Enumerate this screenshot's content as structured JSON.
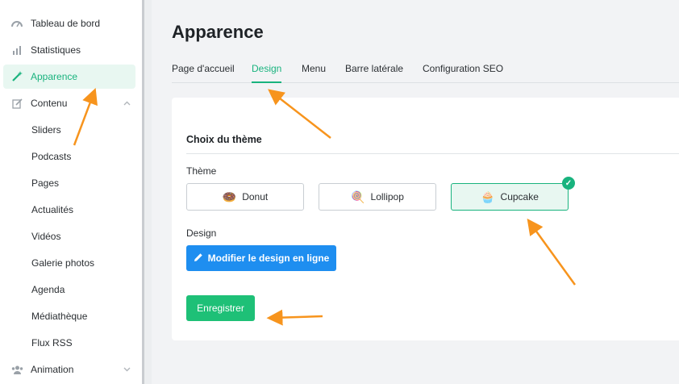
{
  "sidebar": {
    "items": [
      {
        "label": "Tableau de bord",
        "icon": "dashboard-icon"
      },
      {
        "label": "Statistiques",
        "icon": "stats-icon"
      },
      {
        "label": "Apparence",
        "icon": "magic-wand-icon",
        "active": true
      },
      {
        "label": "Contenu",
        "icon": "edit-icon",
        "expanded": true
      },
      {
        "label": "Animation",
        "icon": "users-icon",
        "expanded": false
      }
    ],
    "sub_items": [
      "Sliders",
      "Podcasts",
      "Pages",
      "Actualités",
      "Vidéos",
      "Galerie photos",
      "Agenda",
      "Médiathèque",
      "Flux RSS"
    ]
  },
  "main": {
    "title": "Apparence",
    "tabs": [
      {
        "label": "Page d'accueil"
      },
      {
        "label": "Design",
        "active": true
      },
      {
        "label": "Menu"
      },
      {
        "label": "Barre latérale"
      },
      {
        "label": "Configuration SEO"
      }
    ],
    "section_title": "Choix du thème",
    "theme_label": "Thème",
    "themes": [
      {
        "label": "Donut",
        "emoji": "🍩"
      },
      {
        "label": "Lollipop",
        "emoji": "🍭"
      },
      {
        "label": "Cupcake",
        "emoji": "🧁",
        "selected": true
      }
    ],
    "design_label": "Design",
    "design_button": "Modifier le design en ligne",
    "save_button": "Enregistrer"
  },
  "colors": {
    "accent": "#19b37e",
    "primary_button": "#1e8ef0",
    "save_button": "#1ec077",
    "annotation_arrow": "#f7941d"
  }
}
